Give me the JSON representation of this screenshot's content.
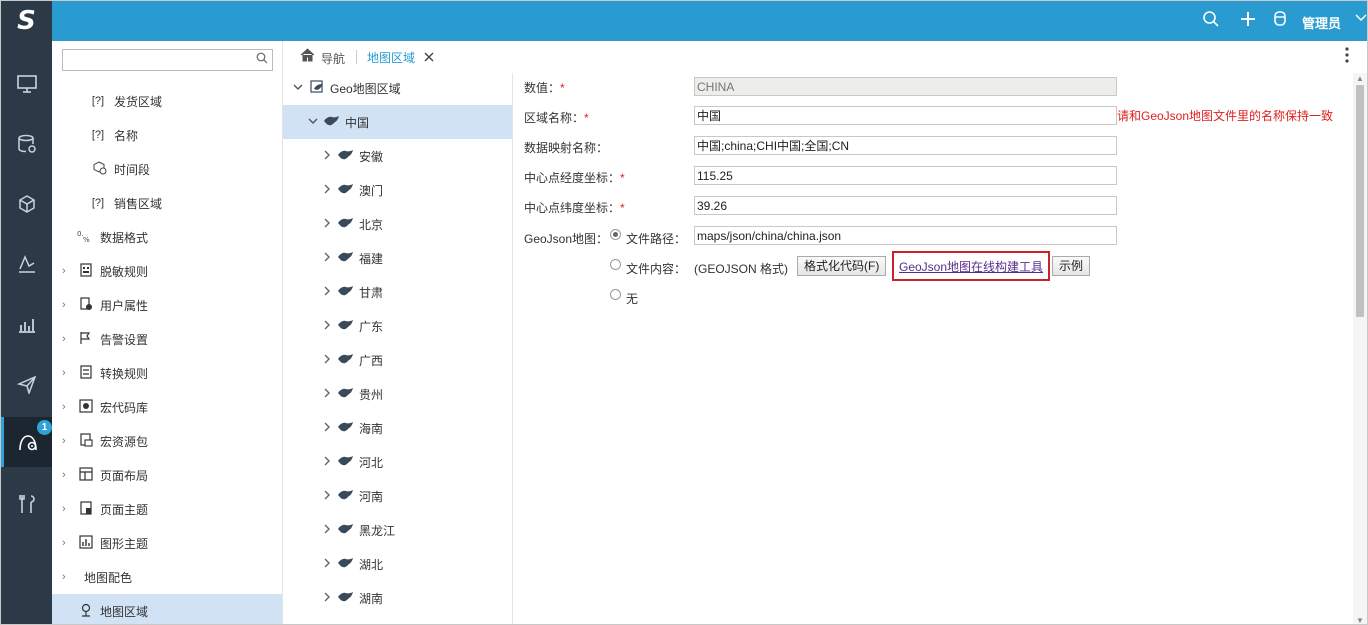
{
  "rail": {
    "logo_text": "S",
    "badge_count": "1"
  },
  "topbar": {
    "user_label": "管理员"
  },
  "tabs": {
    "nav_label": "导航",
    "active_tab": "地图区域"
  },
  "sidebar": {
    "search_placeholder": "",
    "items": [
      {
        "label": "发货区域",
        "icon": "[?]"
      },
      {
        "label": "名称",
        "icon": "[?]"
      },
      {
        "label": "时间段",
        "icon": "cube-clock-icon"
      },
      {
        "label": "销售区域",
        "icon": "[?]"
      },
      {
        "label": "数据格式",
        "icon": "format-icon"
      },
      {
        "label": "脱敏规则",
        "icon": "mask-icon"
      },
      {
        "label": "用户属性",
        "icon": "user-attr-icon"
      },
      {
        "label": "告警设置",
        "icon": "alarm-icon"
      },
      {
        "label": "转换规则",
        "icon": "convert-icon"
      },
      {
        "label": "宏代码库",
        "icon": "macro-icon"
      },
      {
        "label": "宏资源包",
        "icon": "package-icon"
      },
      {
        "label": "页面布局",
        "icon": "layout-icon"
      },
      {
        "label": "页面主题",
        "icon": "theme-icon"
      },
      {
        "label": "图形主题",
        "icon": "chart-theme-icon"
      },
      {
        "label": "地图配色",
        "icon": ""
      },
      {
        "label": "地图区域",
        "icon": "map-pin-icon"
      }
    ]
  },
  "tree": {
    "root": "Geo地图区域",
    "selected": "中国",
    "children": [
      "安徽",
      "澳门",
      "北京",
      "福建",
      "甘肃",
      "广东",
      "广西",
      "贵州",
      "海南",
      "河北",
      "河南",
      "黑龙江",
      "湖北",
      "湖南"
    ]
  },
  "form": {
    "value_label": "数值：",
    "value": "CHINA",
    "region_name_label": "区域名称：",
    "region_name": "中国",
    "hint": "请和GeoJson地图文件里的名称保持一致",
    "mapping_label": "数据映射名称：",
    "mapping": "中国;china;CHI中国;全国;CN",
    "lon_label": "中心点经度坐标：",
    "lon": "115.25",
    "lat_label": "中心点纬度坐标：",
    "lat": "39.26",
    "geojson_label": "GeoJson地图：",
    "opt_file_path": "文件路径：",
    "file_path": "maps/json/china/china.json",
    "opt_file_content": "文件内容：",
    "format_note": "(GEOJSON 格式)",
    "format_button": "格式化代码(F)",
    "tool_link": "GeoJson地图在线构建工具",
    "example_button": "示例",
    "opt_none": "无"
  },
  "colors": {
    "topbar": "#2a9bd0",
    "rail": "#2c3a47",
    "selection": "#d1e2f4",
    "required": "#e02020",
    "highlight_box": "#c8232c"
  }
}
